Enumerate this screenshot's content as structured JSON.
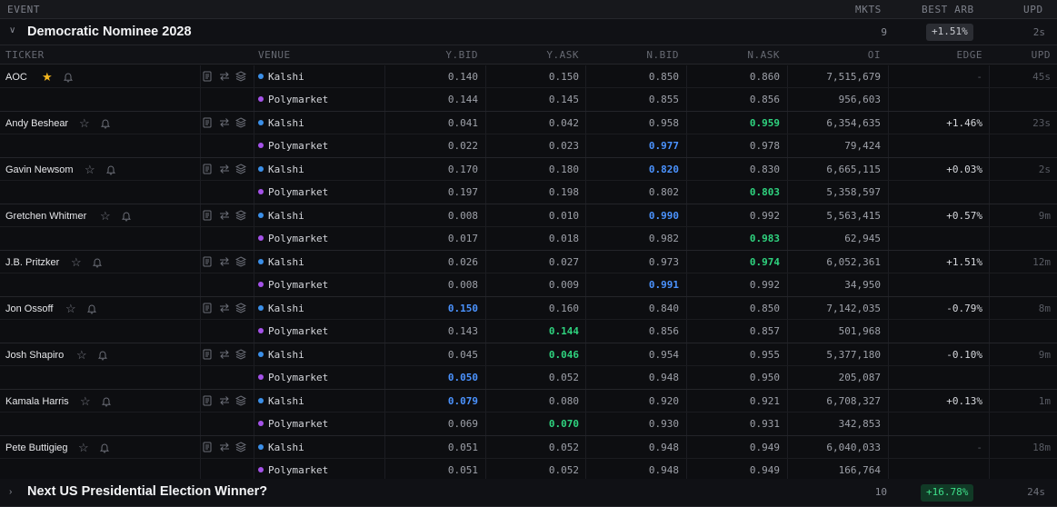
{
  "top_header": {
    "event": "EVENT",
    "mkts": "MKTS",
    "best_arb": "BEST ARB",
    "upd": "UPD"
  },
  "events": [
    {
      "name": "Democratic Nominee 2028",
      "mkts": "9",
      "best_arb": "+1.51%",
      "upd": "2s",
      "expanded": true
    },
    {
      "name": "Next US Presidential Election Winner?",
      "mkts": "10",
      "best_arb": "+16.78%",
      "upd": "24s",
      "expanded": false
    }
  ],
  "columns": {
    "ticker": "TICKER",
    "venue": "VENUE",
    "ybid": "Y.BID",
    "yask": "Y.ASK",
    "nbid": "N.BID",
    "nask": "N.ASK",
    "oi": "OI",
    "edge": "EDGE",
    "upd": "UPD"
  },
  "candidates": [
    {
      "name": "AOC",
      "fav": true,
      "edge": "-",
      "upd": "45s",
      "markets": [
        {
          "venue": "Kalshi",
          "ybid": "0.140",
          "yask": "0.150",
          "nbid": "0.850",
          "nask": "0.860",
          "oi": "7,515,679"
        },
        {
          "venue": "Polymarket",
          "ybid": "0.144",
          "yask": "0.145",
          "nbid": "0.855",
          "nask": "0.856",
          "oi": "956,603"
        }
      ]
    },
    {
      "name": "Andy Beshear",
      "fav": false,
      "edge": "+1.46%",
      "upd": "23s",
      "markets": [
        {
          "venue": "Kalshi",
          "ybid": "0.041",
          "yask": "0.042",
          "nbid": "0.958",
          "nask": "0.959",
          "oi": "6,354,635"
        },
        {
          "venue": "Polymarket",
          "ybid": "0.022",
          "yask": "0.023",
          "nbid": "0.977",
          "nask": "0.978",
          "oi": "79,424"
        }
      ]
    },
    {
      "name": "Gavin Newsom",
      "fav": false,
      "edge": "+0.03%",
      "upd": "2s",
      "markets": [
        {
          "venue": "Kalshi",
          "ybid": "0.170",
          "yask": "0.180",
          "nbid": "0.820",
          "nask": "0.830",
          "oi": "6,665,115"
        },
        {
          "venue": "Polymarket",
          "ybid": "0.197",
          "yask": "0.198",
          "nbid": "0.802",
          "nask": "0.803",
          "oi": "5,358,597"
        }
      ]
    },
    {
      "name": "Gretchen Whitmer",
      "fav": false,
      "edge": "+0.57%",
      "upd": "9m",
      "markets": [
        {
          "venue": "Kalshi",
          "ybid": "0.008",
          "yask": "0.010",
          "nbid": "0.990",
          "nask": "0.992",
          "oi": "5,563,415"
        },
        {
          "venue": "Polymarket",
          "ybid": "0.017",
          "yask": "0.018",
          "nbid": "0.982",
          "nask": "0.983",
          "oi": "62,945"
        }
      ]
    },
    {
      "name": "J.B. Pritzker",
      "fav": false,
      "edge": "+1.51%",
      "upd": "12m",
      "markets": [
        {
          "venue": "Kalshi",
          "ybid": "0.026",
          "yask": "0.027",
          "nbid": "0.973",
          "nask": "0.974",
          "oi": "6,052,361"
        },
        {
          "venue": "Polymarket",
          "ybid": "0.008",
          "yask": "0.009",
          "nbid": "0.991",
          "nask": "0.992",
          "oi": "34,950"
        }
      ]
    },
    {
      "name": "Jon Ossoff",
      "fav": false,
      "edge": "-0.79%",
      "upd": "8m",
      "markets": [
        {
          "venue": "Kalshi",
          "ybid": "0.150",
          "yask": "0.160",
          "nbid": "0.840",
          "nask": "0.850",
          "oi": "7,142,035"
        },
        {
          "venue": "Polymarket",
          "ybid": "0.143",
          "yask": "0.144",
          "nbid": "0.856",
          "nask": "0.857",
          "oi": "501,968"
        }
      ]
    },
    {
      "name": "Josh Shapiro",
      "fav": false,
      "edge": "-0.10%",
      "upd": "9m",
      "markets": [
        {
          "venue": "Kalshi",
          "ybid": "0.045",
          "yask": "0.046",
          "nbid": "0.954",
          "nask": "0.955",
          "oi": "5,377,180"
        },
        {
          "venue": "Polymarket",
          "ybid": "0.050",
          "yask": "0.052",
          "nbid": "0.948",
          "nask": "0.950",
          "oi": "205,087"
        }
      ]
    },
    {
      "name": "Kamala Harris",
      "fav": false,
      "edge": "+0.13%",
      "upd": "1m",
      "markets": [
        {
          "venue": "Kalshi",
          "ybid": "0.079",
          "yask": "0.080",
          "nbid": "0.920",
          "nask": "0.921",
          "oi": "6,708,327"
        },
        {
          "venue": "Polymarket",
          "ybid": "0.069",
          "yask": "0.070",
          "nbid": "0.930",
          "nask": "0.931",
          "oi": "342,853"
        }
      ]
    },
    {
      "name": "Pete Buttigieg",
      "fav": false,
      "edge": "-",
      "upd": "18m",
      "markets": [
        {
          "venue": "Kalshi",
          "ybid": "0.051",
          "yask": "0.052",
          "nbid": "0.948",
          "nask": "0.949",
          "oi": "6,040,033"
        },
        {
          "venue": "Polymarket",
          "ybid": "0.051",
          "yask": "0.052",
          "nbid": "0.948",
          "nask": "0.949",
          "oi": "166,764"
        }
      ]
    }
  ],
  "highlights": {
    "blue": "#4b93ff",
    "green": "#2fd37f",
    "kalshi_dot": "#3b8fe8",
    "polymarket_dot": "#a452e8",
    "cells": [
      {
        "row": 1,
        "market": 0,
        "col": "nask",
        "color": "green"
      },
      {
        "row": 1,
        "market": 1,
        "col": "nbid",
        "color": "blue"
      },
      {
        "row": 2,
        "market": 0,
        "col": "nbid",
        "color": "blue"
      },
      {
        "row": 2,
        "market": 1,
        "col": "nask",
        "color": "green"
      },
      {
        "row": 3,
        "market": 0,
        "col": "nbid",
        "color": "blue"
      },
      {
        "row": 3,
        "market": 1,
        "col": "nask",
        "color": "green"
      },
      {
        "row": 4,
        "market": 0,
        "col": "nask",
        "color": "green"
      },
      {
        "row": 4,
        "market": 1,
        "col": "nbid",
        "color": "blue"
      },
      {
        "row": 5,
        "market": 0,
        "col": "ybid",
        "color": "blue"
      },
      {
        "row": 5,
        "market": 1,
        "col": "yask",
        "color": "green"
      },
      {
        "row": 6,
        "market": 0,
        "col": "yask",
        "color": "green"
      },
      {
        "row": 6,
        "market": 1,
        "col": "ybid",
        "color": "blue"
      },
      {
        "row": 7,
        "market": 0,
        "col": "ybid",
        "color": "blue"
      },
      {
        "row": 7,
        "market": 1,
        "col": "yask",
        "color": "green"
      }
    ]
  },
  "icons": {
    "expand": "chevron-down-icon",
    "collapse": "chevron-right-icon",
    "star": "star-icon",
    "bell": "bell-icon",
    "doc": "document-icon",
    "swap": "swap-arrows-icon",
    "layers": "layers-icon"
  }
}
